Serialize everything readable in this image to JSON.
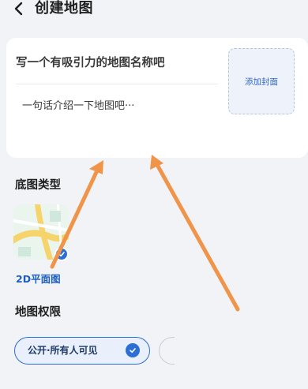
{
  "header": {
    "title": "创建地图",
    "back_icon": "chevron-left-icon"
  },
  "map_info": {
    "name_placeholder": "写一个有吸引力的地图名称吧",
    "intro_placeholder": "一句话介绍一下地图吧···",
    "cover_button_label": "添加封面"
  },
  "base_map": {
    "section_label": "底图类型",
    "selected": {
      "label": "2D平面图",
      "checked": true
    }
  },
  "permission": {
    "section_label": "地图权限",
    "selected": {
      "label": "公开·所有人可见",
      "checked": true
    }
  },
  "colors": {
    "accent": "#2b6fd6",
    "annotation_arrow": "#f0944a",
    "background": "#f1f3f7"
  }
}
